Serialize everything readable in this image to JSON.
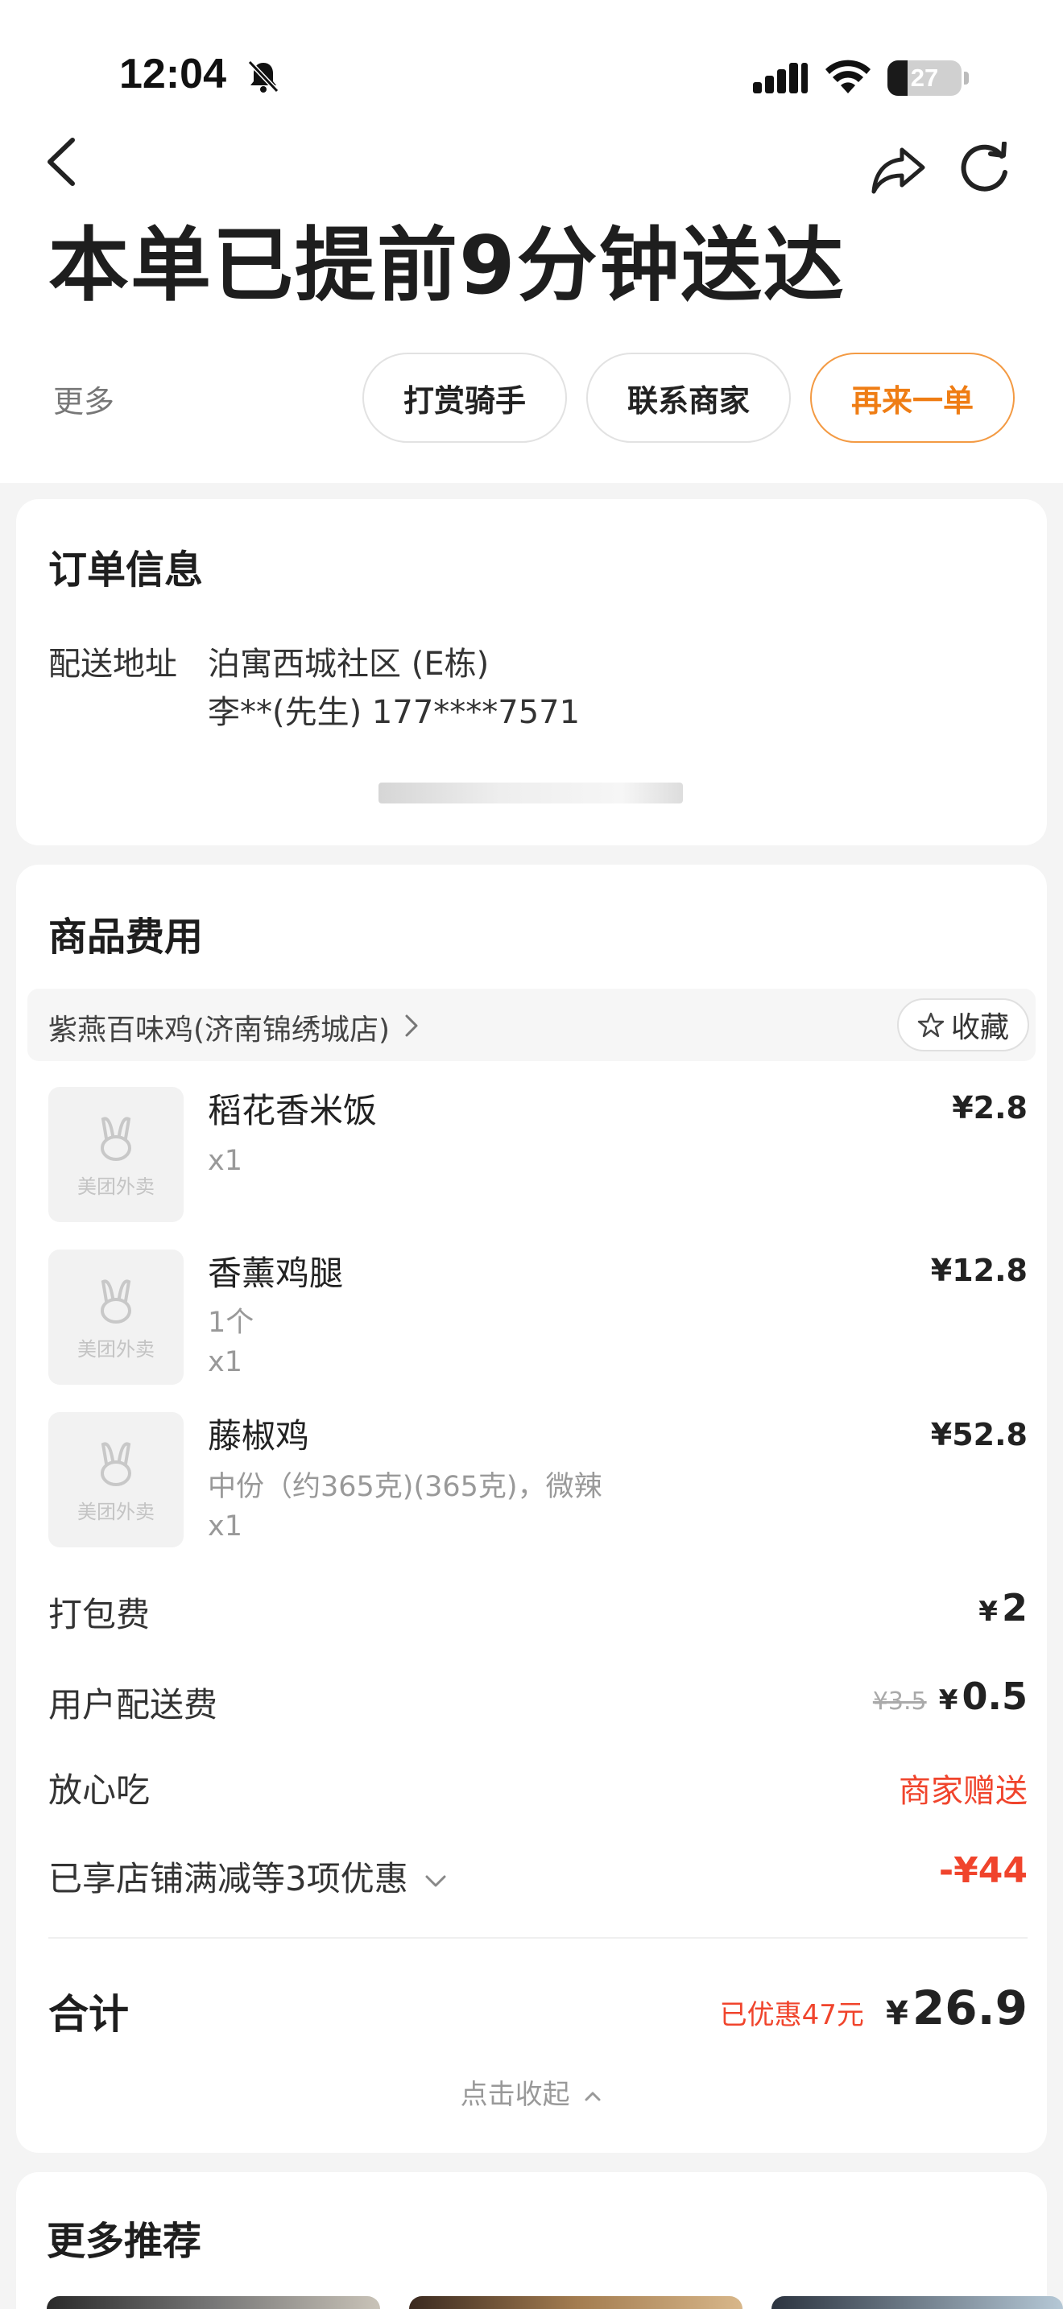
{
  "status_bar": {
    "time": "12:04",
    "battery_level": "27",
    "battery_fraction": 0.27,
    "icons": [
      "bell-muted-icon",
      "signal-icon",
      "wifi-icon",
      "battery-icon"
    ]
  },
  "nav": {
    "icons": [
      "back-icon",
      "share-icon",
      "refresh-icon"
    ]
  },
  "header": {
    "title": "本单已提前9分钟送达",
    "more_label": "更多",
    "actions": {
      "tip_rider": "打赏骑手",
      "contact_merchant": "联系商家",
      "reorder": "再来一单"
    }
  },
  "order_info": {
    "title": "订单信息",
    "address_label": "配送地址",
    "address": "泊寓西城社区 (E栋)",
    "contact": "李**(先生) 177****7571"
  },
  "goods": {
    "title": "商品费用",
    "store_name": "紫燕百味鸡(济南锦绣城店)",
    "favorite_label": "收藏",
    "placeholder_logo_text": "美团外卖",
    "items": [
      {
        "name": "稻花香米饭",
        "spec": "",
        "qty": "x1",
        "price": "¥2.8"
      },
      {
        "name": "香薰鸡腿",
        "spec": "1个",
        "qty": "x1",
        "price": "¥12.8"
      },
      {
        "name": "藤椒鸡",
        "spec": "中份（约365克)(365克)，微辣",
        "qty": "x1",
        "price": "¥52.8"
      }
    ],
    "fees": {
      "packing_label": "打包费",
      "packing_currency": "¥",
      "packing_value": "2",
      "delivery_label": "用户配送费",
      "delivery_original": "¥3.5",
      "delivery_currency": "¥",
      "delivery_value": "0.5",
      "safe_eat_label": "放心吃",
      "safe_eat_value": "商家赠送",
      "discount_label": "已享店铺满减等3项优惠",
      "discount_value": "-¥44"
    },
    "total": {
      "label": "合计",
      "discount_note": "已优惠47元",
      "currency": "¥",
      "value": "26.9"
    },
    "collapse_label": "点击收起"
  },
  "recommend": {
    "title": "更多推荐"
  },
  "colors": {
    "accent_orange": "#ef7d14",
    "price_red": "#f0442c",
    "page_bg": "#f4f4f4",
    "card_bg": "#ffffff"
  }
}
